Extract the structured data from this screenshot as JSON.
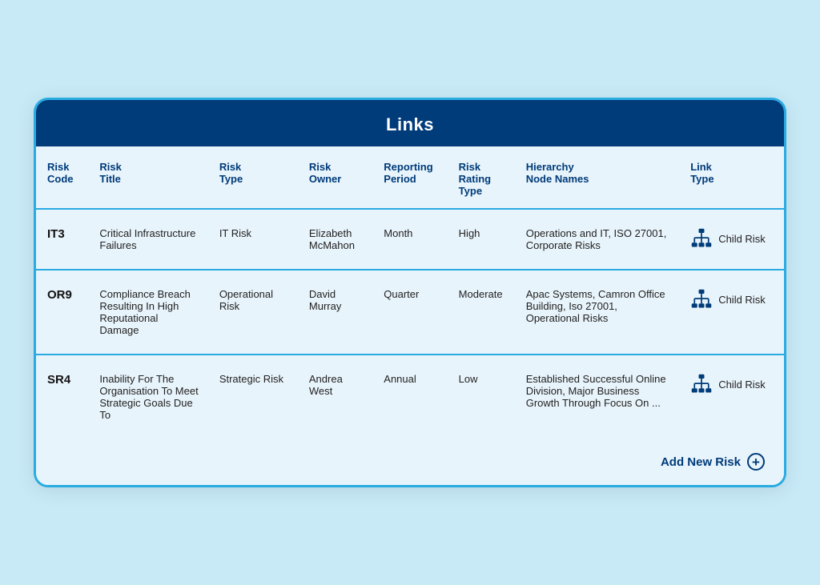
{
  "header": {
    "title": "Links"
  },
  "columns": [
    {
      "id": "risk-code",
      "line1": "Risk",
      "line2": "Code"
    },
    {
      "id": "risk-title",
      "line1": "Risk",
      "line2": "Title"
    },
    {
      "id": "risk-type",
      "line1": "Risk",
      "line2": "Type"
    },
    {
      "id": "risk-owner",
      "line1": "Risk",
      "line2": "Owner"
    },
    {
      "id": "reporting-period",
      "line1": "Reporting",
      "line2": "Period"
    },
    {
      "id": "risk-rating-type",
      "line1": "Risk Rating",
      "line2": "Type"
    },
    {
      "id": "hierarchy-node-names",
      "line1": "Hierarchy",
      "line2": "Node Names"
    },
    {
      "id": "link-type",
      "line1": "Link",
      "line2": "Type"
    }
  ],
  "rows": [
    {
      "code": "IT3",
      "title": "Critical Infrastructure Failures",
      "type": "IT Risk",
      "owner": "Elizabeth McMahon",
      "reporting": "Month",
      "rating": "High",
      "hierarchy": "Operations and IT, ISO 27001, Corporate Risks",
      "link": "Child Risk"
    },
    {
      "code": "OR9",
      "title": "Compliance Breach Resulting In High Reputational Damage",
      "type": "Operational Risk",
      "owner": "David Murray",
      "reporting": "Quarter",
      "rating": "Moderate",
      "hierarchy": "Apac Systems, Camron Office Building, Iso 27001, Operational Risks",
      "link": "Child Risk"
    },
    {
      "code": "SR4",
      "title": "Inability For The Organisation To Meet Strategic Goals Due To",
      "type": "Strategic Risk",
      "owner": "Andrea West",
      "reporting": "Annual",
      "rating": "Low",
      "hierarchy": "Established Successful Online Division, Major Business Growth Through Focus On ...",
      "link": "Child Risk"
    }
  ],
  "footer": {
    "add_label": "Add New Risk"
  }
}
